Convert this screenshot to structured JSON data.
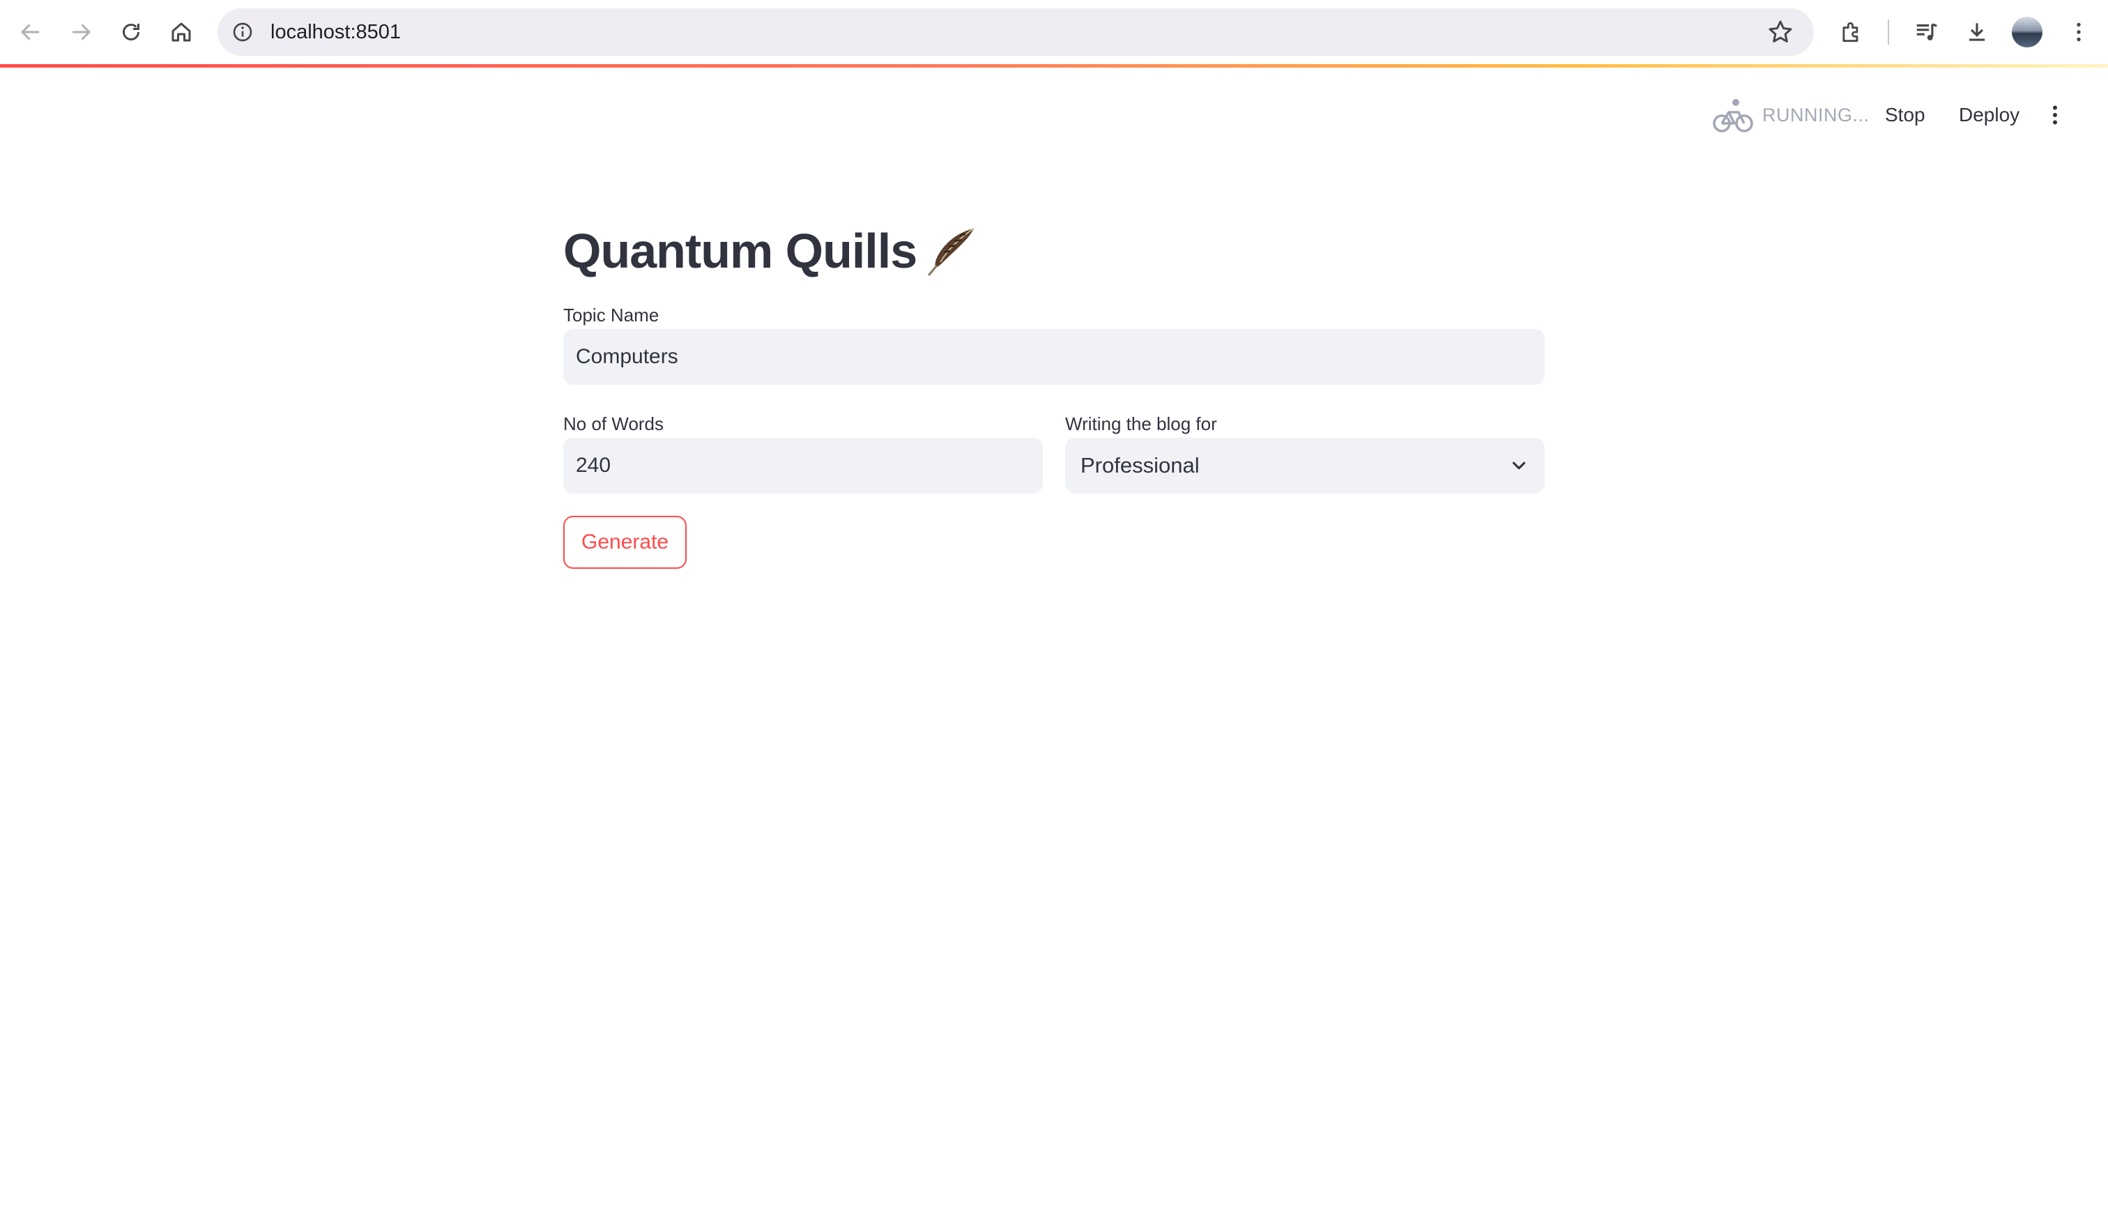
{
  "browser": {
    "url": "localhost:8501",
    "icons": [
      "back-icon",
      "forward-icon",
      "reload-icon",
      "home-icon",
      "site-info-icon",
      "bookmark-star-icon",
      "extensions-icon",
      "media-controls-icon",
      "downloads-icon",
      "profile-avatar",
      "chrome-menu-icon"
    ]
  },
  "header": {
    "status": "RUNNING...",
    "stop_label": "Stop",
    "deploy_label": "Deploy"
  },
  "main": {
    "title": "Quantum Quills",
    "topic": {
      "label": "Topic Name",
      "value": "Computers"
    },
    "words": {
      "label": "No of Words",
      "value": "240"
    },
    "audience": {
      "label": "Writing the blog for",
      "selected": "Professional"
    },
    "generate_label": "Generate"
  },
  "colors": {
    "primary": "#ff4b4b",
    "input_bg": "#f0f2f6",
    "text": "#31333f",
    "status_text": "#a3a8b4"
  }
}
